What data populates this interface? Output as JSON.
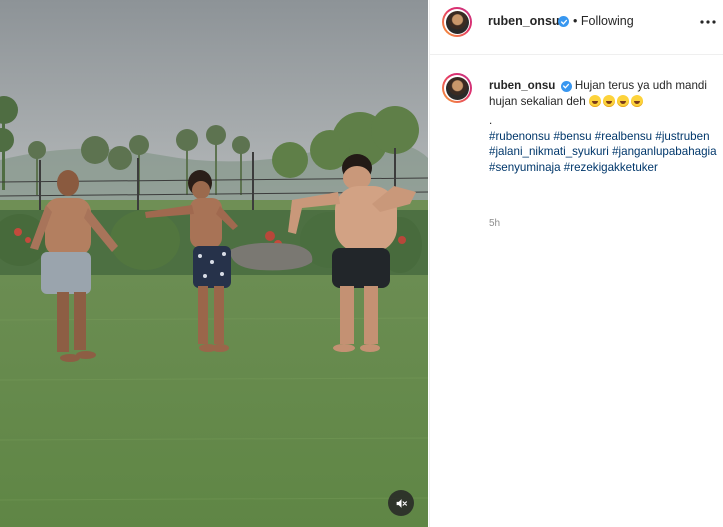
{
  "post": {
    "username": "ruben_onsu",
    "follow_status": "Following",
    "more_label": "...",
    "mute_icon": "speaker-muted-icon",
    "caption": {
      "username": "ruben_onsu",
      "text": "Hujan terus ya udh mandi hujan sekalian deh",
      "emojis": [
        "😂",
        "😂",
        "😂",
        "😂"
      ],
      "dot": ".",
      "hashtags": [
        "#rubenonsu",
        "#bensu",
        "#realbensu",
        "#justruben",
        "#jalani_nikmati_syukuri",
        "#janganlupabahagia",
        "#senyuminaja",
        "#rezekigakketuker"
      ]
    },
    "timestamp": "5h"
  },
  "colors": {
    "verified_blue": "#3897f0",
    "hashtag_blue": "#00376b",
    "muted_text": "#8e8e8e",
    "grass_green": "#6f8f55"
  }
}
